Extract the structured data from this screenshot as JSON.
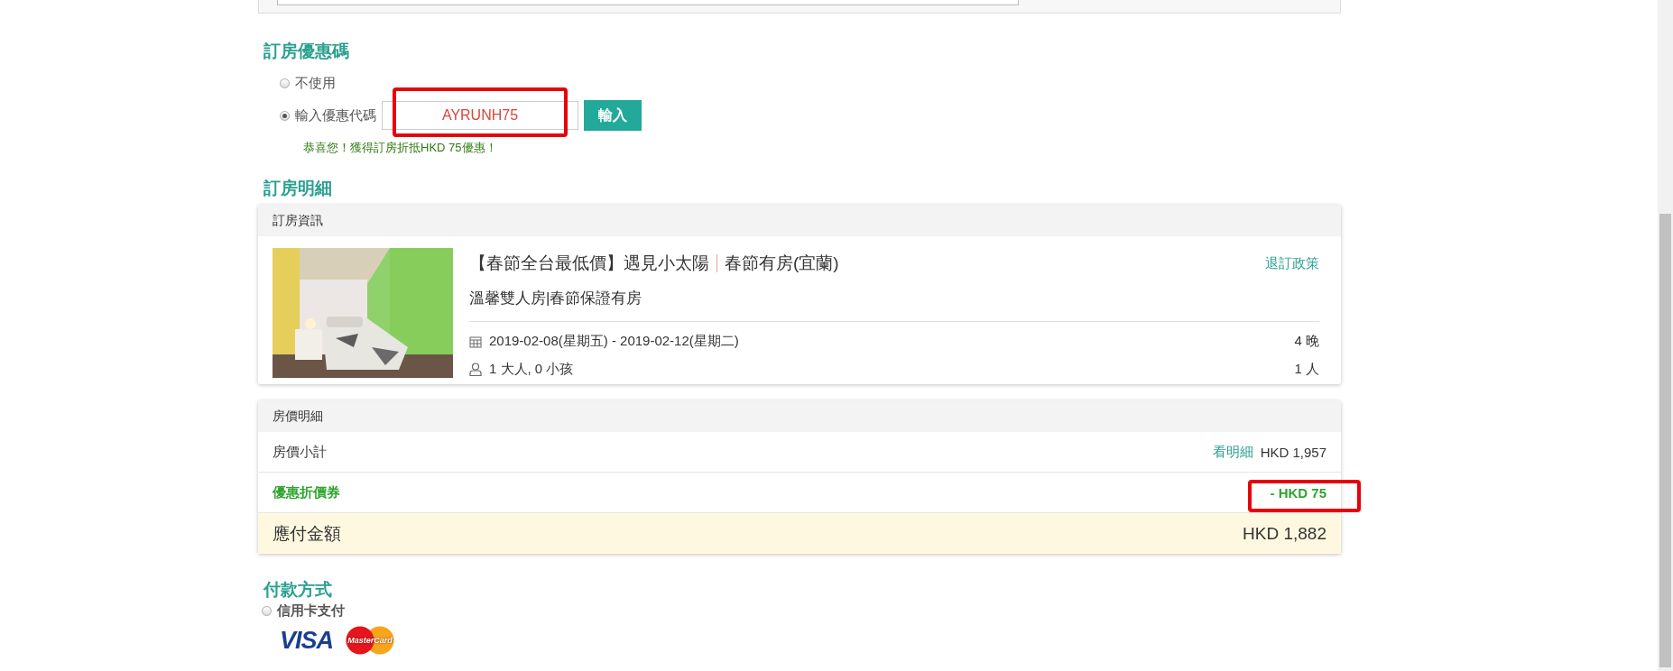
{
  "promo_section": {
    "title": "訂房優惠碼",
    "options": [
      {
        "label": "不使用",
        "selected": false
      },
      {
        "label": "輸入優惠代碼",
        "selected": true
      }
    ],
    "code_field": {
      "value": "AYRUNH75",
      "highlighted": true
    },
    "apply_button": "輸入",
    "message": "恭喜您！獲得訂房折抵HKD 75優惠！"
  },
  "details_section": {
    "title": "訂房明細",
    "booking_card": {
      "header": "訂房資訊",
      "image": {
        "kind": "picture"
      },
      "hotel_name": [
        "【春節全台最低價】遇見小太陽",
        "春節有房(宜蘭)"
      ],
      "policy_link": "退訂政策",
      "room": "溫馨雙人房|春節保證有房",
      "dates": "2019-02-08(星期五) - 2019-02-12(星期二)",
      "nights": "4 晚",
      "guests": "1 大人, 0 小孩",
      "persons": "1 人"
    },
    "price_card": {
      "header": "房價明細",
      "rows": [
        {
          "kind": "subtotal",
          "label": "房價小計",
          "link": "看明細",
          "amount": "HKD 1,957",
          "highlighted": false
        },
        {
          "kind": "discount",
          "label": "優惠折價券",
          "amount": "- HKD 75",
          "highlighted": true
        },
        {
          "kind": "total",
          "label": "應付金額",
          "amount": "HKD 1,882",
          "highlighted": false
        }
      ]
    }
  },
  "payment_section": {
    "title": "付款方式",
    "options": [
      {
        "label": "信用卡支付",
        "selected": false
      }
    ],
    "card_logos": [
      "VISA",
      "MasterCard"
    ]
  }
}
